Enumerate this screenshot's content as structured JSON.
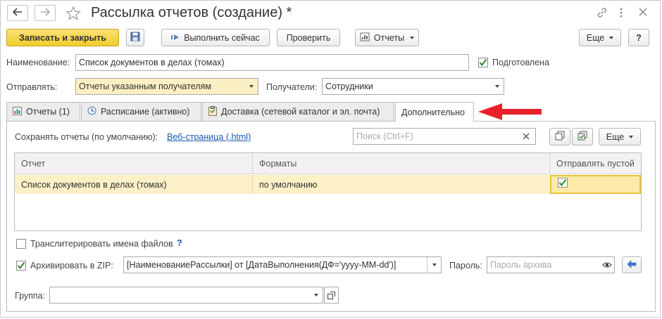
{
  "title": "Рассылка отчетов (создание) *",
  "toolbar": {
    "save_close": "Записать и закрыть",
    "run_now": "Выполнить сейчас",
    "check": "Проверить",
    "reports": "Отчеты",
    "more": "Еще",
    "help": "?"
  },
  "form": {
    "name_label": "Наименование:",
    "name_value": "Список документов в делах (томах)",
    "prepared_label": "Подготовлена",
    "prepared_checked": true,
    "send_label": "Отправлять:",
    "send_value": "Отчеты указанным получателям",
    "recipients_label": "Получатели:",
    "recipients_value": "Сотрудники"
  },
  "tabs": [
    {
      "label": "Отчеты (1)",
      "icon": "report-chart-icon"
    },
    {
      "label": "Расписание (активно)",
      "icon": "schedule-clock-icon"
    },
    {
      "label": "Доставка (сетевой каталог и эл. почта)",
      "icon": "delivery-clipboard-icon"
    },
    {
      "label": "Дополнительно",
      "active": true
    }
  ],
  "panel": {
    "save_reports_label": "Сохранять отчеты (по умолчанию):",
    "save_reports_link": "Веб-страница (.html)",
    "search_placeholder": "Поиск (Ctrl+F)",
    "more": "Еще",
    "table": {
      "columns": [
        "Отчет",
        "Форматы",
        "Отправлять пустой"
      ],
      "rows": [
        {
          "report": "Список документов в делах (томах)",
          "formats": "по умолчанию",
          "send_empty": true
        }
      ]
    },
    "transliterate_label": "Транслитерировать имена файлов",
    "transliterate_checked": false,
    "help_mark": "?",
    "zip_label": "Архивировать в ZIP:",
    "zip_checked": true,
    "zip_value": "[НаименованиеРассылки] от [ДатаВыполнения(ДФ='yyyy-MM-dd')]",
    "password_label": "Пароль:",
    "password_placeholder": "Пароль архива",
    "group_label": "Группа:",
    "group_value": ""
  },
  "colors": {
    "primary_button": "#f6d23c",
    "selected_row": "#fbf0c6",
    "link": "#1a57b0",
    "arrow": "#e8202a",
    "check": "#2d8a2d"
  }
}
